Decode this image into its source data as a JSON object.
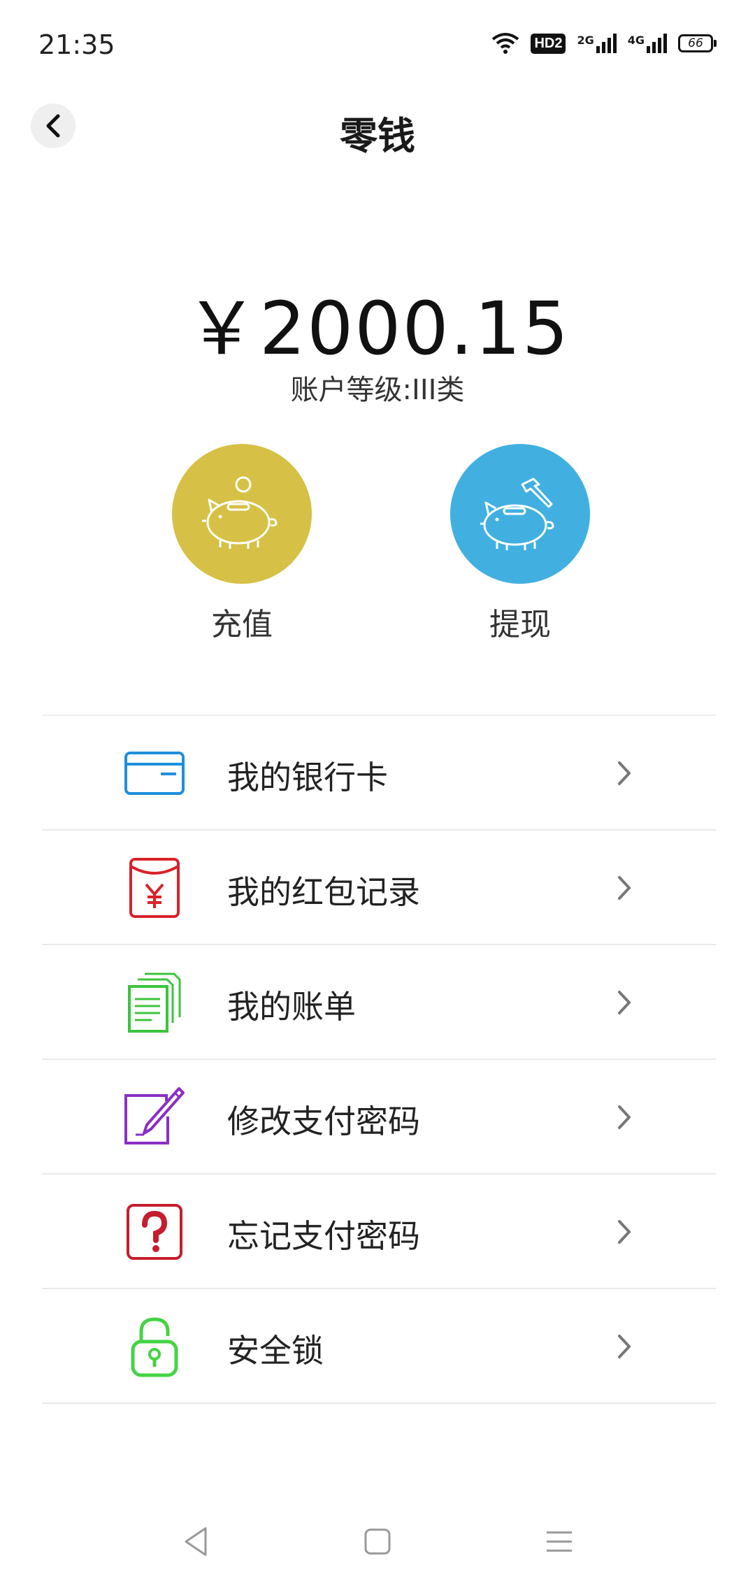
{
  "status_bar": {
    "time": "21:35",
    "hd_label": "HD2",
    "net1_label": "2G",
    "net2_label": "4G",
    "battery": "66",
    "icons": [
      "wifi-icon",
      "hd-icon",
      "signal-2g-icon",
      "signal-4g-icon",
      "battery-icon"
    ]
  },
  "header": {
    "title": "零钱",
    "back_icon": "chevron-left-icon"
  },
  "wallet": {
    "balance": "￥2000.15",
    "account_level": "账户等级:III类"
  },
  "actions": [
    {
      "label": "充值",
      "icon": "piggy-bank-coin-icon",
      "color": "#d6c146"
    },
    {
      "label": "提现",
      "icon": "piggy-bank-hammer-icon",
      "color": "#41b0e1"
    }
  ],
  "menu": [
    {
      "label": "我的银行卡",
      "icon": "bank-card-icon",
      "color": "#1e8fdc"
    },
    {
      "label": "我的红包记录",
      "icon": "red-envelope-icon",
      "color": "#d8222a"
    },
    {
      "label": "我的账单",
      "icon": "bill-documents-icon",
      "color": "#3cc43c"
    },
    {
      "label": "修改支付密码",
      "icon": "edit-pen-icon",
      "color": "#8a2fc4"
    },
    {
      "label": "忘记支付密码",
      "icon": "question-icon",
      "color": "#c41e2e"
    },
    {
      "label": "安全锁",
      "icon": "lock-icon",
      "color": "#44d344"
    }
  ],
  "nav_bar": {
    "icons": [
      "back-triangle-icon",
      "home-square-icon",
      "menu-lines-icon"
    ]
  }
}
